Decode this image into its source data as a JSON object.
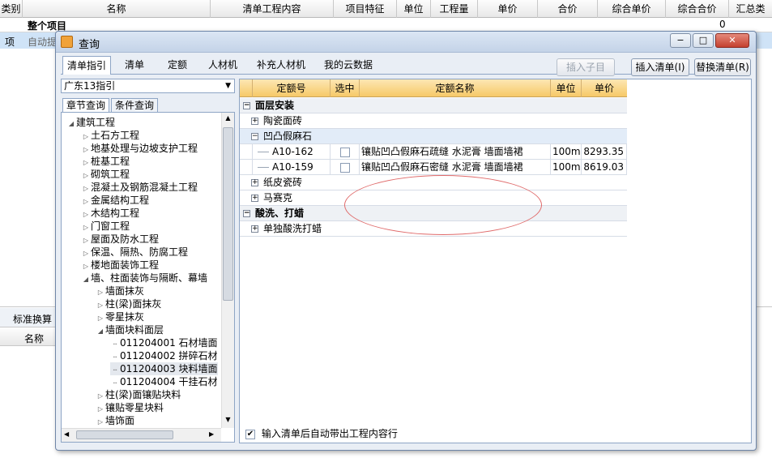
{
  "background": {
    "columns": [
      "类别",
      "名称",
      "清单工程内容",
      "项目特征",
      "单位",
      "工程量",
      "单价",
      "合价",
      "综合单价",
      "综合合价",
      "汇总类"
    ],
    "row1": {
      "name": "整个项目",
      "total": "0"
    },
    "row2": {
      "type": "项",
      "name": "自动提"
    },
    "lower_tab": "标准换算",
    "lower_col": "名称"
  },
  "dialog": {
    "title": "查询",
    "tabs": [
      "清单指引",
      "清单",
      "定额",
      "人材机",
      "补充人材机",
      "我的云数据"
    ],
    "buttons": {
      "insert_child": "插入子目",
      "insert_list": "插入清单(I)",
      "replace_list": "替换清单(R)"
    },
    "combo_value": "广东13指引",
    "subtabs": [
      "章节查询",
      "条件查询"
    ],
    "tree": [
      {
        "label": "建筑工程",
        "indent": 0,
        "open": true
      },
      {
        "label": "土石方工程",
        "indent": 1
      },
      {
        "label": "地基处理与边坡支护工程",
        "indent": 1
      },
      {
        "label": "桩基工程",
        "indent": 1
      },
      {
        "label": "砌筑工程",
        "indent": 1
      },
      {
        "label": "混凝土及钢筋混凝土工程",
        "indent": 1
      },
      {
        "label": "金属结构工程",
        "indent": 1
      },
      {
        "label": "木结构工程",
        "indent": 1
      },
      {
        "label": "门窗工程",
        "indent": 1
      },
      {
        "label": "屋面及防水工程",
        "indent": 1
      },
      {
        "label": "保温、隔热、防腐工程",
        "indent": 1
      },
      {
        "label": "楼地面装饰工程",
        "indent": 1
      },
      {
        "label": "墙、柱面装饰与隔断、幕墙",
        "indent": 1,
        "open": true
      },
      {
        "label": "墙面抹灰",
        "indent": 2
      },
      {
        "label": "柱(梁)面抹灰",
        "indent": 2
      },
      {
        "label": "零星抹灰",
        "indent": 2
      },
      {
        "label": "墙面块料面层",
        "indent": 2,
        "open": true
      },
      {
        "label": "011204001  石材墙面",
        "indent": 3,
        "leaf": true
      },
      {
        "label": "011204002  拼碎石材",
        "indent": 3,
        "leaf": true
      },
      {
        "label": "011204003  块料墙面",
        "indent": 3,
        "leaf": true,
        "selected": true
      },
      {
        "label": "011204004  干挂石材",
        "indent": 3,
        "leaf": true
      },
      {
        "label": "柱(梁)面镶贴块料",
        "indent": 2
      },
      {
        "label": "镶贴零星块料",
        "indent": 2
      },
      {
        "label": "墙饰面",
        "indent": 2
      }
    ],
    "grid": {
      "headers": [
        "定额号",
        "选中",
        "定额名称",
        "单位",
        "单价"
      ],
      "rows": [
        {
          "kind": "group",
          "label": "面层安装",
          "exp": "−"
        },
        {
          "kind": "sub",
          "label": "陶瓷面砖",
          "exp": "+"
        },
        {
          "kind": "sub",
          "label": "凹凸假麻石",
          "exp": "−",
          "highlight": true
        },
        {
          "kind": "item",
          "code": "A10-162",
          "name": "镶贴凹凸假麻石疏缝 水泥膏 墙面墙裙",
          "unit": "100m2",
          "price": "8293.35"
        },
        {
          "kind": "item",
          "code": "A10-159",
          "name": "镶贴凹凸假麻石密缝 水泥膏 墙面墙裙",
          "unit": "100m2",
          "price": "8619.03"
        },
        {
          "kind": "sub",
          "label": "纸皮瓷砖",
          "exp": "+"
        },
        {
          "kind": "sub",
          "label": "马赛克",
          "exp": "+"
        },
        {
          "kind": "group",
          "label": "酸洗、打蜡",
          "exp": "−"
        },
        {
          "kind": "sub",
          "label": "单独酸洗打蜡",
          "exp": "+"
        }
      ]
    },
    "auto_checkbox_label": "输入清单后自动带出工程内容行"
  },
  "colors": {
    "header_gold": "#f6c968",
    "selection_blue": "#cfe3f7",
    "annotation_red": "#e06a6a"
  }
}
